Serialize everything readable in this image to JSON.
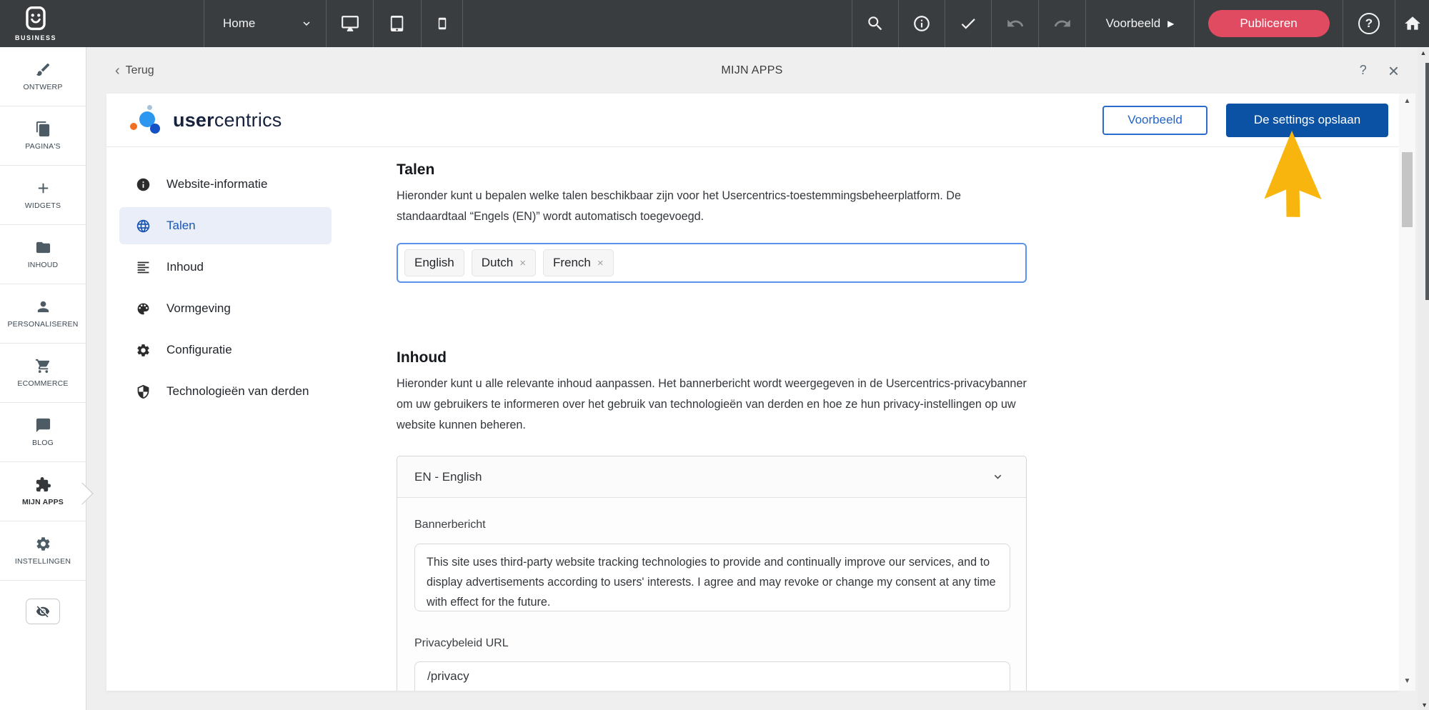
{
  "topbar": {
    "logo_label": "BUSINESS",
    "page_selector_value": "Home",
    "preview_label": "Voorbeeld",
    "publish_label": "Publiceren"
  },
  "sidebar": {
    "items": [
      {
        "label": "ONTWERP",
        "icon": "brush-icon"
      },
      {
        "label": "PAGINA'S",
        "icon": "pages-icon"
      },
      {
        "label": "WIDGETS",
        "icon": "plus-icon"
      },
      {
        "label": "INHOUD",
        "icon": "folder-icon"
      },
      {
        "label": "PERSONALISEREN",
        "icon": "person-icon"
      },
      {
        "label": "ECOMMERCE",
        "icon": "cart-icon"
      },
      {
        "label": "BLOG",
        "icon": "chat-icon"
      },
      {
        "label": "MIJN APPS",
        "icon": "puzzle-icon",
        "active": true
      },
      {
        "label": "INSTELLINGEN",
        "icon": "gear-icon"
      }
    ]
  },
  "modal": {
    "back_label": "Terug",
    "title": "MIJN APPS"
  },
  "uc": {
    "brand_bold": "user",
    "brand_light": "centrics",
    "preview_label": "Voorbeeld",
    "save_label": "De settings opslaan",
    "nav": [
      {
        "label": "Website-informatie",
        "icon": "info-icon",
        "active": false
      },
      {
        "label": "Talen",
        "icon": "globe-icon",
        "active": true
      },
      {
        "label": "Inhoud",
        "icon": "text-lines-icon",
        "active": false
      },
      {
        "label": "Vormgeving",
        "icon": "palette-icon",
        "active": false
      },
      {
        "label": "Configuratie",
        "icon": "gear-icon",
        "active": false
      },
      {
        "label": "Technologieën van derden",
        "icon": "shield-icon",
        "active": false
      }
    ],
    "talen": {
      "title": "Talen",
      "description": "Hieronder kunt u bepalen welke talen beschikbaar zijn voor het Usercentrics-toestemmingsbeheerplatform. De standaardtaal “Engels (EN)” wordt automatisch toegevoegd.",
      "tags": [
        {
          "label": "English",
          "removable": false
        },
        {
          "label": "Dutch",
          "removable": true
        },
        {
          "label": "French",
          "removable": true
        }
      ]
    },
    "inhoud": {
      "title": "Inhoud",
      "description": "Hieronder kunt u alle relevante inhoud aanpassen. Het bannerbericht wordt weergegeven in de Usercentrics-privacybanner om uw gebruikers te informeren over het gebruik van technologieën van derden en hoe ze hun privacy-instellingen op uw website kunnen beheren.",
      "language_selected": "EN - English",
      "banner_label": "Bannerbericht",
      "banner_text": "This site uses third-party website tracking technologies to provide and continually improve our services, and to display advertisements according to users' interests. I agree and may revoke or change my consent at any time with effect for the future.",
      "privacy_label": "Privacybeleid URL",
      "privacy_value": "/privacy"
    }
  },
  "icons": {
    "back_chevron": "‹",
    "help": "?",
    "close": "×",
    "play": "▶",
    "scroll_up": "▲",
    "scroll_down": "▼",
    "tag_remove": "×"
  },
  "colors": {
    "topbar_bg": "#393d40",
    "publish_pink": "#e04b61",
    "save_blue": "#0b52a4",
    "outline_blue": "#2b6bca",
    "active_nav_bg": "#e9eef8",
    "active_nav_blue": "#1b57b2",
    "tag_border_blue": "#5d92ec",
    "cursor_yellow": "#f8b50e"
  }
}
